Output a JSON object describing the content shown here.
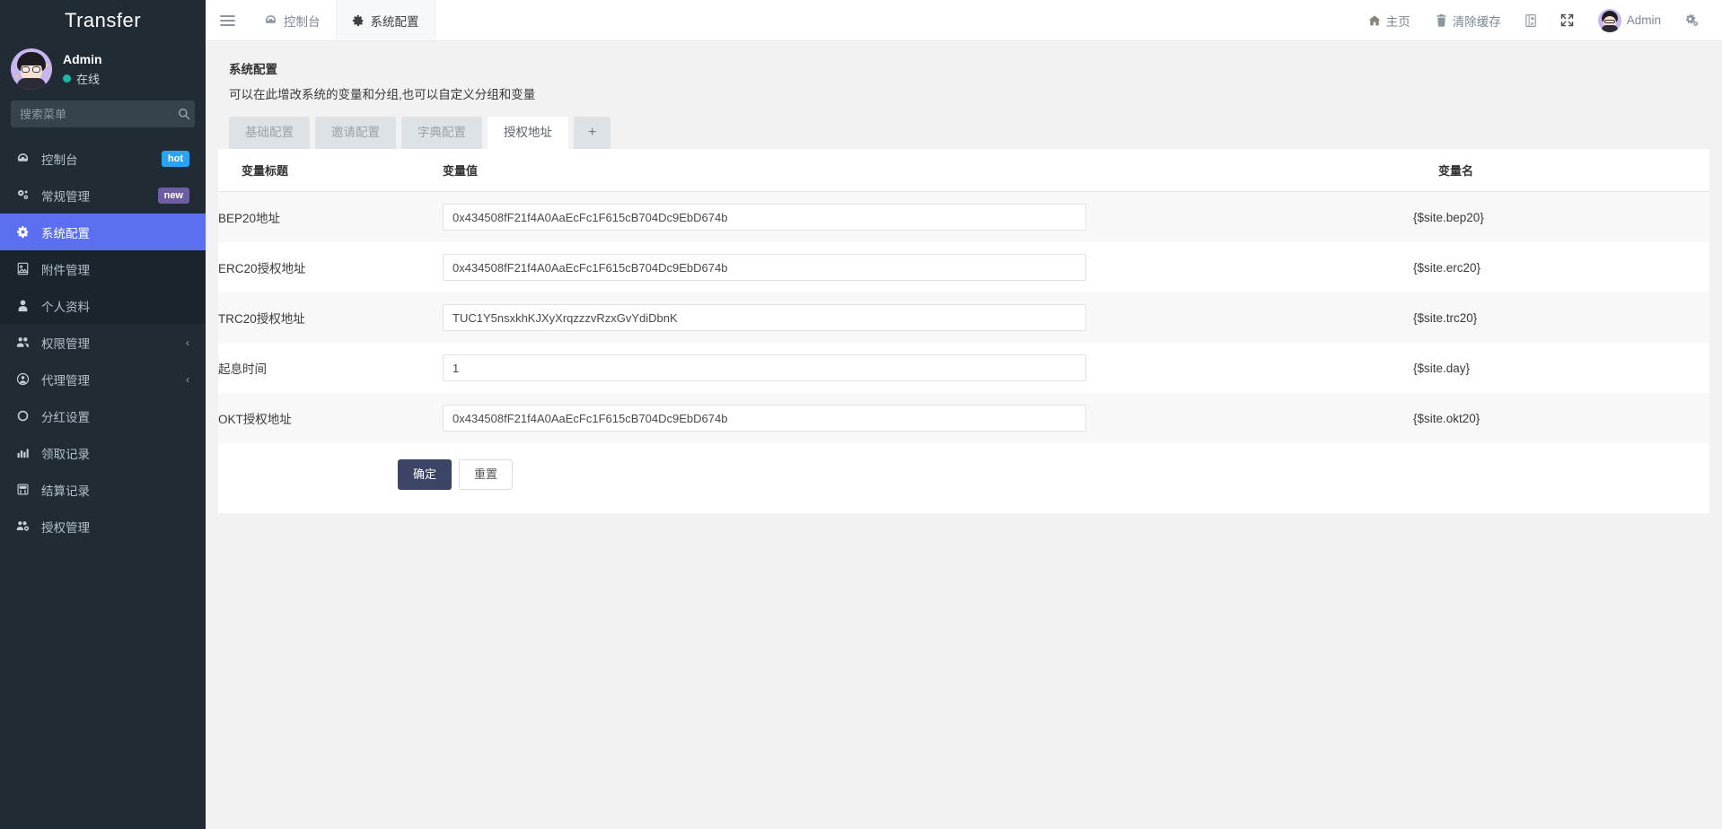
{
  "sidebar": {
    "brand": "Transfer",
    "profile": {
      "name": "Admin",
      "status": "在线",
      "avatar_icon": "user-avatar"
    },
    "search": {
      "placeholder": "搜索菜单",
      "value": "",
      "icon": "search-icon"
    },
    "items": [
      {
        "label": "控制台",
        "icon": "dashboard-icon",
        "badge": "hot",
        "badge_type": "hot",
        "state": "normal",
        "chevron": ""
      },
      {
        "label": "常规管理",
        "icon": "cogs-icon",
        "badge": "new",
        "badge_type": "new",
        "state": "normal",
        "chevron": ""
      },
      {
        "label": "系统配置",
        "icon": "gear-icon",
        "badge": "",
        "badge_type": "",
        "state": "active",
        "chevron": ""
      },
      {
        "label": "附件管理",
        "icon": "file-image-icon",
        "badge": "",
        "badge_type": "",
        "state": "dim",
        "chevron": ""
      },
      {
        "label": "个人资料",
        "icon": "user-icon",
        "badge": "",
        "badge_type": "",
        "state": "dim",
        "chevron": ""
      },
      {
        "label": "权限管理",
        "icon": "users-icon",
        "badge": "",
        "badge_type": "",
        "state": "normal",
        "chevron": "‹"
      },
      {
        "label": "代理管理",
        "icon": "user-circle-icon",
        "badge": "",
        "badge_type": "",
        "state": "normal",
        "chevron": "‹"
      },
      {
        "label": "分红设置",
        "icon": "circle-icon",
        "badge": "",
        "badge_type": "",
        "state": "normal",
        "chevron": ""
      },
      {
        "label": "领取记录",
        "icon": "chart-icon",
        "badge": "",
        "badge_type": "",
        "state": "normal",
        "chevron": ""
      },
      {
        "label": "结算记录",
        "icon": "calculator-icon",
        "badge": "",
        "badge_type": "",
        "state": "normal",
        "chevron": ""
      },
      {
        "label": "授权管理",
        "icon": "users-cog-icon",
        "badge": "",
        "badge_type": "",
        "state": "normal",
        "chevron": ""
      }
    ]
  },
  "topbar": {
    "menu_toggle_icon": "hamburger-icon",
    "tabs": [
      {
        "label": "控制台",
        "icon": "dashboard-icon",
        "active": false
      },
      {
        "label": "系统配置",
        "icon": "gear-icon",
        "active": true
      }
    ],
    "right": {
      "home_label": "主页",
      "home_icon": "home-icon",
      "clear_cache_label": "清除缓存",
      "clear_cache_icon": "trash-icon",
      "theme_icon": "theme-palette-icon",
      "fullscreen_icon": "fullscreen-expand-icon",
      "user_label": "Admin",
      "user_avatar_icon": "user-avatar",
      "settings_icon": "cogs-settings-icon"
    }
  },
  "page": {
    "title": "系统配置",
    "subtitle": "可以在此增改系统的变量和分组,也可以自定义分组和变量",
    "tabs": [
      {
        "label": "基础配置",
        "active": false
      },
      {
        "label": "邀请配置",
        "active": false
      },
      {
        "label": "字典配置",
        "active": false
      },
      {
        "label": "授权地址",
        "active": true
      }
    ],
    "add_tab_label": "+"
  },
  "table": {
    "headers": [
      "变量标题",
      "变量值",
      "变量名"
    ],
    "rows": [
      {
        "title": "BEP20地址",
        "value": "0x434508fF21f4A0AaEcFc1F615cB704Dc9EbD674b",
        "varname": "{$site.bep20}"
      },
      {
        "title": "ERC20授权地址",
        "value": "0x434508fF21f4A0AaEcFc1F615cB704Dc9EbD674b",
        "varname": "{$site.erc20}"
      },
      {
        "title": "TRC20授权地址",
        "value": "TUC1Y5nsxkhKJXyXrqzzzvRzxGvYdiDbnK",
        "varname": "{$site.trc20}"
      },
      {
        "title": "起息时间",
        "value": "1",
        "varname": "{$site.day}"
      },
      {
        "title": "OKT授权地址",
        "value": "0x434508fF21f4A0AaEcFc1F615cB704Dc9EbD674b",
        "varname": "{$site.okt20}"
      }
    ]
  },
  "form_actions": {
    "submit_label": "确定",
    "reset_label": "重置"
  },
  "colors": {
    "sidebar_bg": "#202b33",
    "sidebar_active": "#5b6ff0",
    "badge_hot": "#2aa3f5",
    "badge_new": "#6c5ea0",
    "primary_button": "#3c4566",
    "online_dot": "#1db8a2",
    "page_bg": "#f2f2f2"
  }
}
